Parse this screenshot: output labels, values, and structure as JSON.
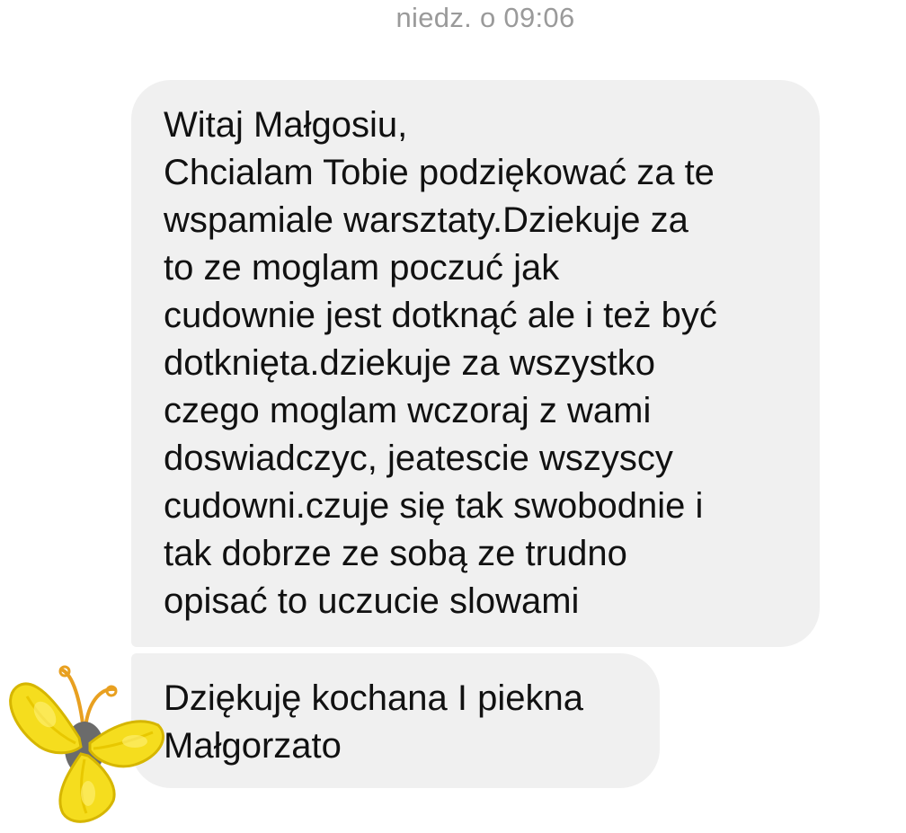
{
  "conversation": {
    "timestamp": "niedz. o 09:06",
    "messages": [
      {
        "text": "Witaj Małgosiu,\nChcialam Tobie podziękować za te\nwspamiale warsztaty.Dziekuje za\nto ze moglam poczuć jak\ncudownie jest dotknąć ale i też być\ndotknięta.dziekuje za wszystko\nczego moglam wczoraj z wami\ndoswiadczyc, jeatescie wszyscy\ncudowni.czuje się tak swobodnie i\ntak dobrze ze sobą ze trudno\nopisać to uczucie slowami"
      },
      {
        "text": "Dziękuję kochana I piekna\nMałgorzato"
      }
    ],
    "sender_avatar": {
      "icon": "butterfly-icon",
      "colors": {
        "wing": "#f5dd1e",
        "wing_outline": "#d6b600",
        "body": "#6b6b6b",
        "antenna": "#e8a020"
      }
    },
    "colors": {
      "bubble_bg": "#f0f0f0",
      "text": "#111111",
      "timestamp": "#9a9a9a",
      "background": "#ffffff"
    }
  }
}
